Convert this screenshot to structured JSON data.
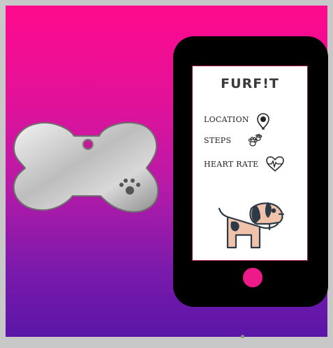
{
  "app": {
    "brand_name": "FURF!T"
  },
  "features": [
    {
      "label": "LOCATION",
      "icon": "location-pin-icon"
    },
    {
      "label": "STEPS",
      "icon": "paw-steps-icon"
    },
    {
      "label": "HEART RATE",
      "icon": "heart-rate-icon"
    }
  ],
  "colors": {
    "gradient_top": "#ff0a8c",
    "gradient_bottom": "#5a16a8",
    "phone_body": "#000000",
    "home_button": "#ee1a8a"
  }
}
